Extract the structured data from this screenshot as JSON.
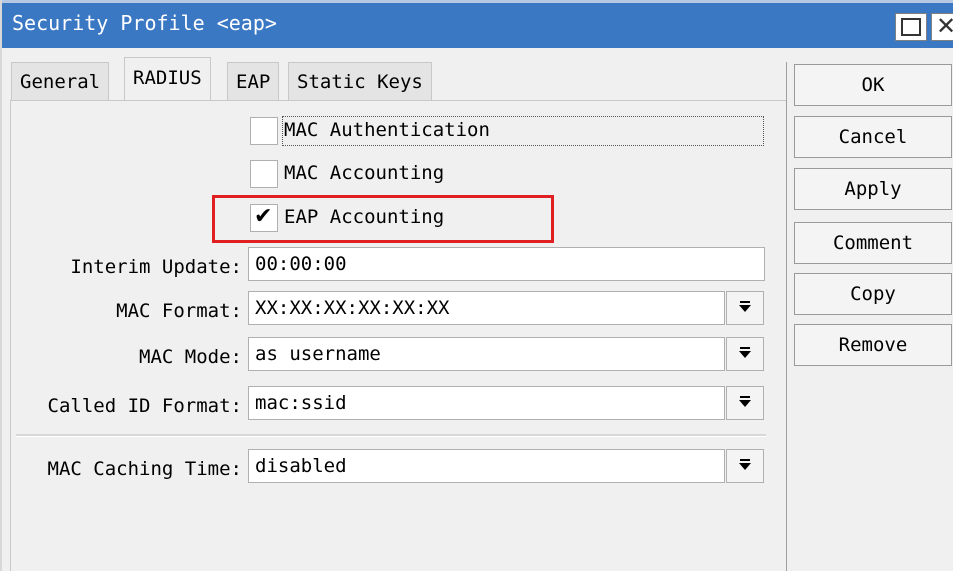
{
  "window": {
    "title": "Security Profile <eap>"
  },
  "tabs": [
    {
      "label": "General",
      "active": false
    },
    {
      "label": "RADIUS",
      "active": true
    },
    {
      "label": "EAP",
      "active": false
    },
    {
      "label": "Static Keys",
      "active": false
    }
  ],
  "checkboxes": {
    "mac_authentication": {
      "label": "MAC Authentication",
      "checked": false
    },
    "mac_accounting": {
      "label": "MAC Accounting",
      "checked": false
    },
    "eap_accounting": {
      "label": "EAP Accounting",
      "checked": true,
      "check_glyph": "✔"
    }
  },
  "fields": {
    "interim_update": {
      "label": "Interim Update:",
      "value": "00:00:00"
    },
    "mac_format": {
      "label": "MAC Format:",
      "value": "XX:XX:XX:XX:XX:XX"
    },
    "mac_mode": {
      "label": "MAC Mode:",
      "value": "as username"
    },
    "called_id_format": {
      "label": "Called ID Format:",
      "value": "mac:ssid"
    },
    "mac_caching_time": {
      "label": "MAC Caching Time:",
      "value": "disabled"
    }
  },
  "buttons": {
    "ok": "OK",
    "cancel": "Cancel",
    "apply": "Apply",
    "comment": "Comment",
    "copy": "Copy",
    "remove": "Remove"
  },
  "icons": {
    "maximize": "maximize-icon",
    "close": "close-icon",
    "close_glyph": "✕",
    "dropdown": "dropdown-arrow-icon"
  },
  "colors": {
    "titlebar": "#3b78c4",
    "highlight": "#e02020",
    "panel": "#f0f0f0"
  }
}
